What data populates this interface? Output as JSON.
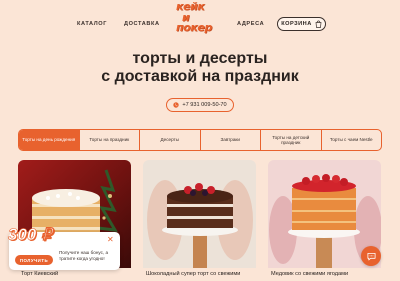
{
  "header": {
    "nav": [
      {
        "label": "КАТАЛОГ"
      },
      {
        "label": "ДОСТАВКА"
      },
      {
        "label": "АДРЕСА"
      }
    ],
    "logo": [
      "кейк",
      "и",
      "покер"
    ],
    "cart_label": "КОРЗИНА"
  },
  "hero": {
    "title_line1": "торты и десерты",
    "title_line2": "с доставкой на праздник",
    "phone": "+7 931 009-50-70"
  },
  "tabs": [
    {
      "label": "Торты на день рождения",
      "active": true
    },
    {
      "label": "Торты на праздник",
      "active": false
    },
    {
      "label": "Десерты",
      "active": false
    },
    {
      "label": "Завтраки",
      "active": false
    },
    {
      "label": "Торты на детский праздник",
      "active": false
    },
    {
      "label": "Торты с чаем Nestle",
      "active": false
    }
  ],
  "products": [
    {
      "title": "Торт Киевский"
    },
    {
      "title": "Шоколадный супер торт со свежими"
    },
    {
      "title": "Медовик со свежими ягодами"
    }
  ],
  "promo": {
    "price": "300 ₽",
    "text": "Получите наш бонус, а тратите когда угодно!",
    "button": "ПОЛУЧИТЬ"
  },
  "colors": {
    "accent": "#e8622e",
    "background": "#fbe5d6",
    "text": "#2a2320"
  }
}
